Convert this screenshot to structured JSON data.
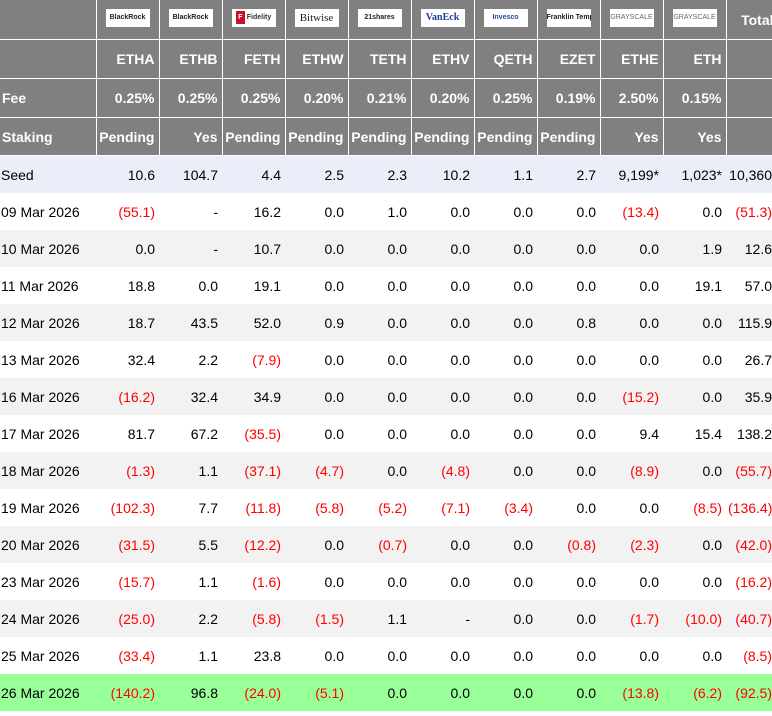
{
  "header": {
    "total_label": "Total",
    "fee_label": "Fee",
    "staking_label": "Staking",
    "logos": [
      "BlackRock",
      "BlackRock",
      "Fidelity",
      "Bitwise",
      "21shares",
      "VanEck",
      "Invesco",
      "Franklin Templeton",
      "GRAYSCALE",
      "GRAYSCALE"
    ],
    "tickers": [
      "ETHA",
      "ETHB",
      "FETH",
      "ETHW",
      "TETH",
      "ETHV",
      "QETH",
      "EZET",
      "ETHE",
      "ETH"
    ],
    "fees": [
      "0.25%",
      "0.25%",
      "0.25%",
      "0.20%",
      "0.21%",
      "0.20%",
      "0.25%",
      "0.19%",
      "2.50%",
      "0.15%"
    ],
    "staking": [
      "Pending",
      "Yes",
      "Pending",
      "Pending",
      "Pending",
      "Pending",
      "Pending",
      "Pending",
      "Yes",
      "Yes"
    ]
  },
  "colors": {
    "header_bg": "#808080",
    "negative": "#ff0000",
    "seed_bg": "#e9eef8",
    "latest_bg": "#99ff99",
    "alt_bg": "#f2f2f2"
  },
  "rows": [
    {
      "label": "Seed",
      "values": [
        "10.6",
        "104.7",
        "4.4",
        "2.5",
        "2.3",
        "10.2",
        "1.1",
        "2.7",
        "9,199*",
        "1,023*",
        "10,360"
      ]
    },
    {
      "label": "09 Mar 2026",
      "values": [
        "(55.1)",
        "-",
        "16.2",
        "0.0",
        "1.0",
        "0.0",
        "0.0",
        "0.0",
        "(13.4)",
        "0.0",
        "(51.3)"
      ]
    },
    {
      "label": "10 Mar 2026",
      "values": [
        "0.0",
        "-",
        "10.7",
        "0.0",
        "0.0",
        "0.0",
        "0.0",
        "0.0",
        "0.0",
        "1.9",
        "12.6"
      ]
    },
    {
      "label": "11 Mar 2026",
      "values": [
        "18.8",
        "0.0",
        "19.1",
        "0.0",
        "0.0",
        "0.0",
        "0.0",
        "0.0",
        "0.0",
        "19.1",
        "57.0"
      ]
    },
    {
      "label": "12 Mar 2026",
      "values": [
        "18.7",
        "43.5",
        "52.0",
        "0.9",
        "0.0",
        "0.0",
        "0.0",
        "0.8",
        "0.0",
        "0.0",
        "115.9"
      ]
    },
    {
      "label": "13 Mar 2026",
      "values": [
        "32.4",
        "2.2",
        "(7.9)",
        "0.0",
        "0.0",
        "0.0",
        "0.0",
        "0.0",
        "0.0",
        "0.0",
        "26.7"
      ]
    },
    {
      "label": "16 Mar 2026",
      "values": [
        "(16.2)",
        "32.4",
        "34.9",
        "0.0",
        "0.0",
        "0.0",
        "0.0",
        "0.0",
        "(15.2)",
        "0.0",
        "35.9"
      ]
    },
    {
      "label": "17 Mar 2026",
      "values": [
        "81.7",
        "67.2",
        "(35.5)",
        "0.0",
        "0.0",
        "0.0",
        "0.0",
        "0.0",
        "9.4",
        "15.4",
        "138.2"
      ]
    },
    {
      "label": "18 Mar 2026",
      "values": [
        "(1.3)",
        "1.1",
        "(37.1)",
        "(4.7)",
        "0.0",
        "(4.8)",
        "0.0",
        "0.0",
        "(8.9)",
        "0.0",
        "(55.7)"
      ]
    },
    {
      "label": "19 Mar 2026",
      "values": [
        "(102.3)",
        "7.7",
        "(11.8)",
        "(5.8)",
        "(5.2)",
        "(7.1)",
        "(3.4)",
        "0.0",
        "0.0",
        "(8.5)",
        "(136.4)"
      ]
    },
    {
      "label": "20 Mar 2026",
      "values": [
        "(31.5)",
        "5.5",
        "(12.2)",
        "0.0",
        "(0.7)",
        "0.0",
        "0.0",
        "(0.8)",
        "(2.3)",
        "0.0",
        "(42.0)"
      ]
    },
    {
      "label": "23 Mar 2026",
      "values": [
        "(15.7)",
        "1.1",
        "(1.6)",
        "0.0",
        "0.0",
        "0.0",
        "0.0",
        "0.0",
        "0.0",
        "0.0",
        "(16.2)"
      ]
    },
    {
      "label": "24 Mar 2026",
      "values": [
        "(25.0)",
        "2.2",
        "(5.8)",
        "(1.5)",
        "1.1",
        "-",
        "0.0",
        "0.0",
        "(1.7)",
        "(10.0)",
        "(40.7)"
      ]
    },
    {
      "label": "25 Mar 2026",
      "values": [
        "(33.4)",
        "1.1",
        "23.8",
        "0.0",
        "0.0",
        "0.0",
        "0.0",
        "0.0",
        "0.0",
        "0.0",
        "(8.5)"
      ]
    },
    {
      "label": "26 Mar 2026",
      "values": [
        "(140.2)",
        "96.8",
        "(24.0)",
        "(5.1)",
        "0.0",
        "0.0",
        "0.0",
        "0.0",
        "(13.8)",
        "(6.2)",
        "(92.5)"
      ]
    }
  ]
}
